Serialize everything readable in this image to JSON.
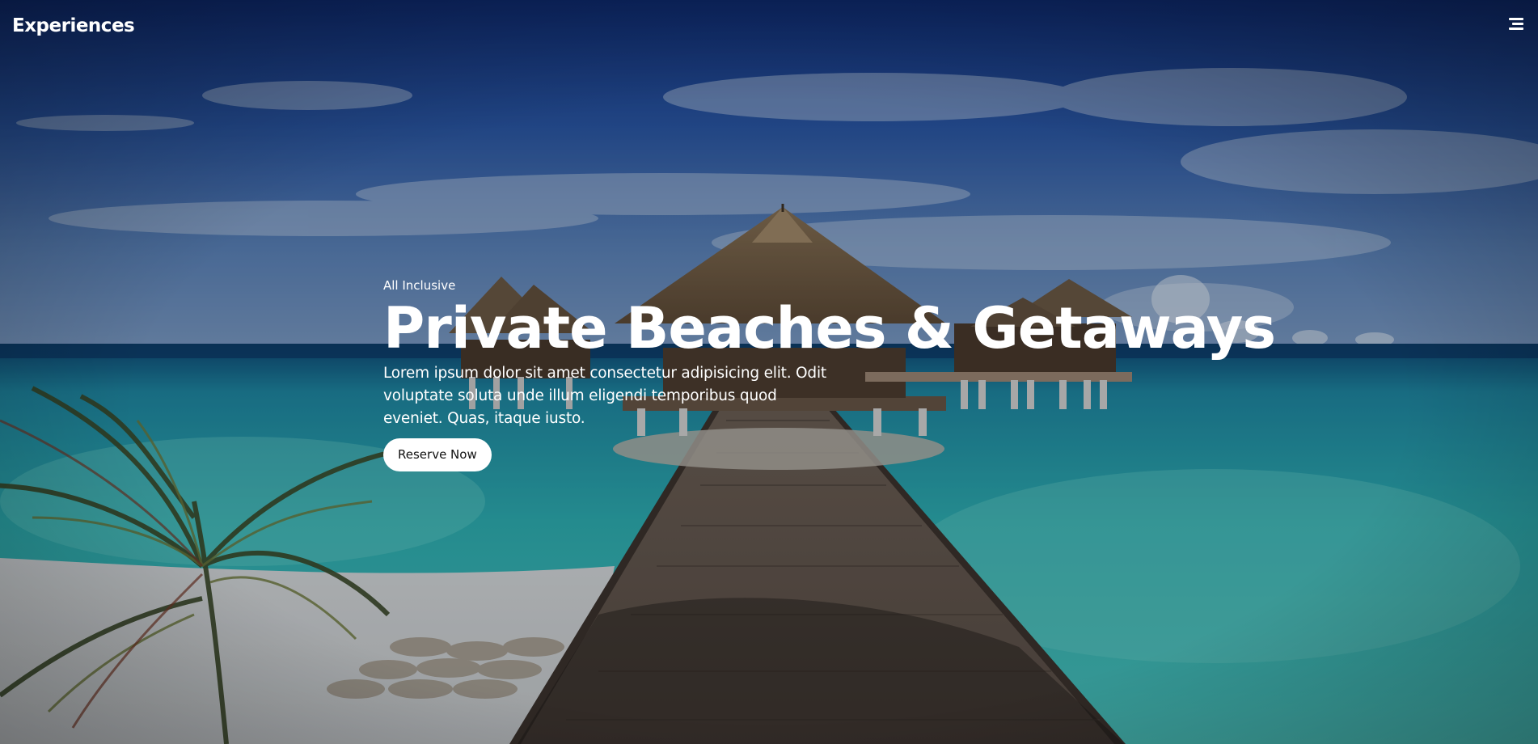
{
  "header": {
    "brand": "Experiences",
    "menu_icon": "hamburger-menu-icon"
  },
  "hero": {
    "eyebrow": "All Inclusive",
    "headline": "Private Beaches & Getaways",
    "lead": "Lorem ipsum dolor sit amet consectetur adipisicing elit. Odit voluptate soluta unde illum eligendi temporibus quod eveniet. Quas, itaque iusto.",
    "cta_label": "Reserve Now",
    "background": "tropical-beach-overwater-bungalows-image"
  },
  "colors": {
    "text": "#ffffff",
    "button_bg": "#ffffff",
    "button_text": "#111111",
    "sky_top": "#10307e",
    "sea": "#2fb3b7"
  }
}
